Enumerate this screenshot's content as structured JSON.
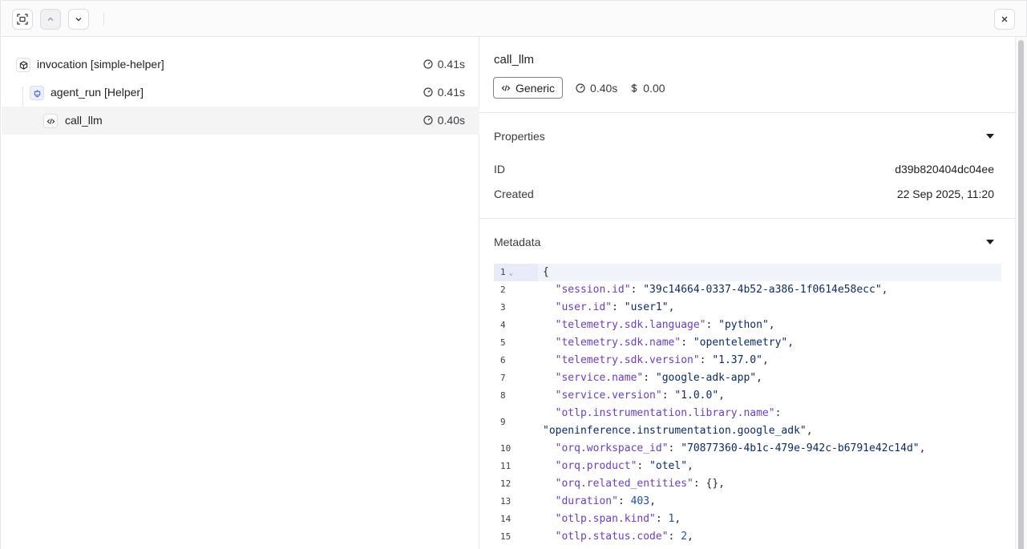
{
  "toolbar": {
    "focus_icon": "focus-frame-icon",
    "prev_icon": "chevron-up-icon",
    "next_icon": "chevron-down-icon",
    "close_icon": "close-icon"
  },
  "tree": [
    {
      "label": "invocation [simple-helper]",
      "duration": "0.41s",
      "kind": "invocation"
    },
    {
      "label": "agent_run [Helper]",
      "duration": "0.41s",
      "kind": "agent"
    },
    {
      "label": "call_llm",
      "duration": "0.40s",
      "kind": "generic"
    }
  ],
  "detail": {
    "title": "call_llm",
    "type_label": "Generic",
    "duration": "0.40s",
    "cost": "0.00",
    "properties": {
      "heading": "Properties",
      "id_label": "ID",
      "id_value": "d39b820404dc04ee",
      "created_label": "Created",
      "created_value": "22 Sep 2025, 11:20"
    },
    "metadata": {
      "heading": "Metadata",
      "lines": [
        {
          "n": "1",
          "open": "{"
        },
        {
          "n": "2",
          "k": "\"session.id\"",
          "v": "\"39c14664-0337-4b52-a386-1f0614e58ecc\"",
          "t": "s"
        },
        {
          "n": "3",
          "k": "\"user.id\"",
          "v": "\"user1\"",
          "t": "s"
        },
        {
          "n": "4",
          "k": "\"telemetry.sdk.language\"",
          "v": "\"python\"",
          "t": "s"
        },
        {
          "n": "5",
          "k": "\"telemetry.sdk.name\"",
          "v": "\"opentelemetry\"",
          "t": "s"
        },
        {
          "n": "6",
          "k": "\"telemetry.sdk.version\"",
          "v": "\"1.37.0\"",
          "t": "s"
        },
        {
          "n": "7",
          "k": "\"service.name\"",
          "v": "\"google-adk-app\"",
          "t": "s"
        },
        {
          "n": "8",
          "k": "\"service.version\"",
          "v": "\"1.0.0\"",
          "t": "s"
        },
        {
          "n": "9",
          "k": "\"otlp.instrumentation.library.name\"",
          "v": "\"openinference.instrumentation.google_adk\"",
          "t": "s",
          "wrap": true
        },
        {
          "n": "10",
          "k": "\"orq.workspace_id\"",
          "v": "\"70877360-4b1c-479e-942c-b6791e42c14d\"",
          "t": "s"
        },
        {
          "n": "11",
          "k": "\"orq.product\"",
          "v": "\"otel\"",
          "t": "s"
        },
        {
          "n": "12",
          "k": "\"orq.related_entities\"",
          "v": "{}",
          "t": "p"
        },
        {
          "n": "13",
          "k": "\"duration\"",
          "v": "403",
          "t": "n"
        },
        {
          "n": "14",
          "k": "\"otlp.span.kind\"",
          "v": "1",
          "t": "n"
        },
        {
          "n": "15",
          "k": "\"otlp.status.code\"",
          "v": "2",
          "t": "n"
        }
      ]
    }
  }
}
